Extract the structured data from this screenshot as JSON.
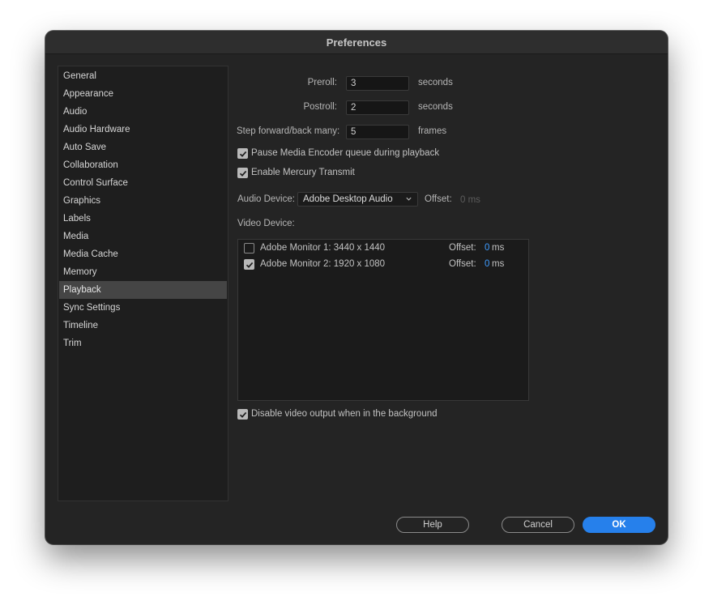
{
  "window": {
    "title": "Preferences"
  },
  "sidebar": {
    "items": [
      {
        "label": "General"
      },
      {
        "label": "Appearance"
      },
      {
        "label": "Audio"
      },
      {
        "label": "Audio Hardware"
      },
      {
        "label": "Auto Save"
      },
      {
        "label": "Collaboration"
      },
      {
        "label": "Control Surface"
      },
      {
        "label": "Graphics"
      },
      {
        "label": "Labels"
      },
      {
        "label": "Media"
      },
      {
        "label": "Media Cache"
      },
      {
        "label": "Memory"
      },
      {
        "label": "Playback",
        "selected": true
      },
      {
        "label": "Sync Settings"
      },
      {
        "label": "Timeline"
      },
      {
        "label": "Trim"
      }
    ]
  },
  "playback": {
    "preroll": {
      "label": "Preroll:",
      "value": "3",
      "unit": "seconds"
    },
    "postroll": {
      "label": "Postroll:",
      "value": "2",
      "unit": "seconds"
    },
    "step": {
      "label": "Step forward/back many:",
      "value": "5",
      "unit": "frames"
    },
    "pause_encoder": {
      "label": "Pause Media Encoder queue during playback",
      "checked": true
    },
    "mercury": {
      "label": "Enable Mercury Transmit",
      "checked": true
    },
    "audio_device": {
      "label": "Audio Device:",
      "selected": "Adobe Desktop Audio",
      "offset_label": "Offset:",
      "offset_value": "0 ms"
    },
    "video_device": {
      "label": "Video Device:",
      "devices": [
        {
          "name": "Adobe Monitor 1: 3440 x 1440",
          "checked": false,
          "offset_label": "Offset:",
          "offset_value": "0",
          "offset_unit": "ms"
        },
        {
          "name": "Adobe Monitor 2: 1920 x 1080",
          "checked": true,
          "offset_label": "Offset:",
          "offset_value": "0",
          "offset_unit": "ms"
        }
      ]
    },
    "disable_bg": {
      "label": "Disable video output when in the background",
      "checked": true
    }
  },
  "buttons": {
    "help": "Help",
    "cancel": "Cancel",
    "ok": "OK"
  },
  "colors": {
    "accent": "#2680eb",
    "offset_value": "#3f9cff",
    "window_bg": "#242424",
    "selected_item": "#454545"
  },
  "icons": {
    "checkbox_checked": "checkmark-icon",
    "dropdown": "chevron-down-icon"
  }
}
